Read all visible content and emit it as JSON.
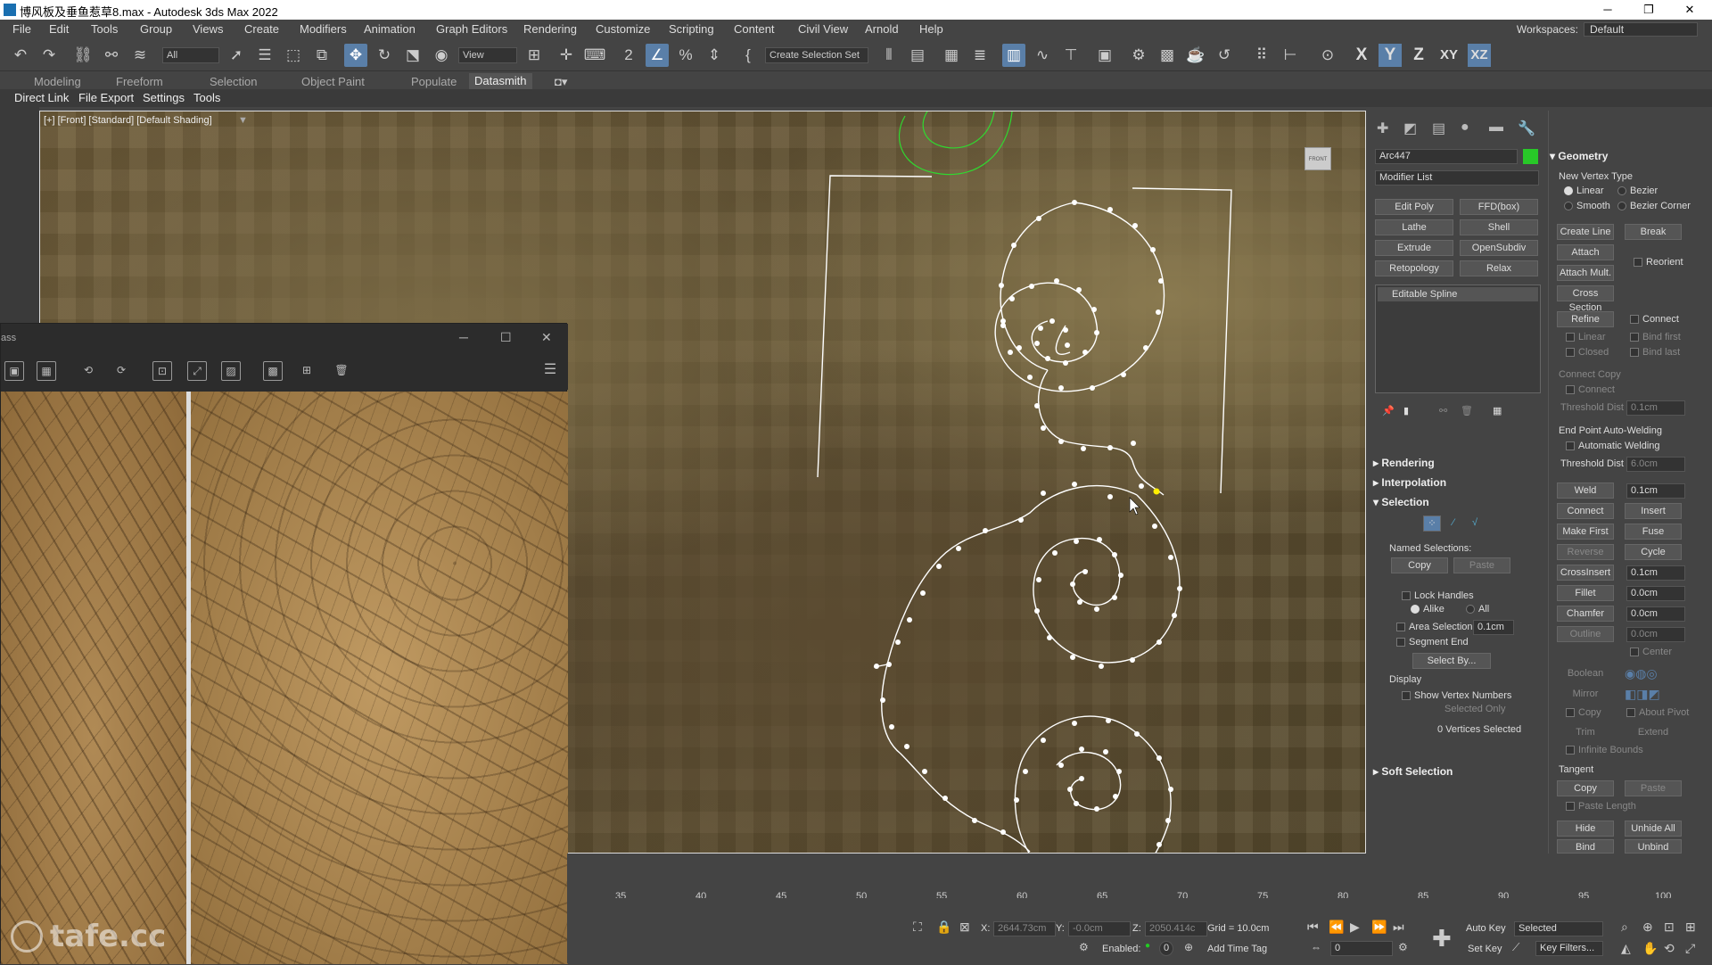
{
  "app": {
    "title": "博风板及垂鱼惹草8.max - Autodesk 3ds Max 2022"
  },
  "menu": [
    "File",
    "Edit",
    "Tools",
    "Group",
    "Views",
    "Create",
    "Modifiers",
    "Animation",
    "Graph Editors",
    "Rendering",
    "Customize",
    "Scripting",
    "Content",
    "Civil View",
    "Arnold",
    "Help"
  ],
  "workspaces": {
    "label": "Workspaces:",
    "value": "Default"
  },
  "toolbar": {
    "filter": "All",
    "refcoord": "View",
    "selset": "Create Selection Set",
    "axes": [
      "X",
      "Y",
      "Z",
      "XY",
      "XZ"
    ]
  },
  "ribbon": {
    "tabs": [
      "Modeling",
      "Freeform",
      "Selection",
      "Object Paint",
      "Populate",
      "Datasmith"
    ]
  },
  "subribbon": [
    "Direct Link",
    "File Export",
    "Settings",
    "Tools"
  ],
  "viewport": {
    "label": "[+] [Front] [Standard] [Default Shading]",
    "cube": "FRONT"
  },
  "floatwin": {
    "title": "ass"
  },
  "watermark": "tafe.cc",
  "panel": {
    "objname": "Arc447",
    "modlist": "Modifier List",
    "mods": [
      "Edit Poly",
      "FFD(box)",
      "Lathe",
      "Shell",
      "Extrude",
      "OpenSubdiv",
      "Retopology",
      "Relax"
    ],
    "stack": "Editable Spline",
    "rollouts": {
      "rendering": "Rendering",
      "interpolation": "Interpolation",
      "selection": "Selection",
      "softsel": "Soft Selection",
      "geometry": "Geometry"
    },
    "selection": {
      "named": "Named Selections:",
      "copy": "Copy",
      "paste": "Paste",
      "lock": "Lock Handles",
      "alike": "Alike",
      "all": "All",
      "area": "Area Selection",
      "areaval": "0.1cm",
      "segend": "Segment End",
      "selectby": "Select By...",
      "display": "Display",
      "shownum": "Show Vertex Numbers",
      "selonly": "Selected Only",
      "count": "0 Vertices Selected"
    },
    "geometry": {
      "nvt": "New Vertex Type",
      "linear": "Linear",
      "bezier": "Bezier",
      "smooth": "Smooth",
      "bezcorner": "Bezier Corner",
      "createline": "Create Line",
      "break": "Break",
      "attach": "Attach",
      "reorient": "Reorient",
      "attachmult": "Attach Mult.",
      "crosssection": "Cross Section",
      "refine": "Refine",
      "connect": "Connect",
      "linear2": "Linear",
      "bindfirst": "Bind first",
      "closed": "Closed",
      "bindlast": "Bind last",
      "connectcopy": "Connect Copy",
      "connect2": "Connect",
      "thresh": "Threshold Dist",
      "threshval": "0.1cm",
      "epaw": "End Point Auto-Welding",
      "autoweld": "Automatic Welding",
      "thresh2": "Threshold Dist",
      "threshval2": "6.0cm",
      "weld": "Weld",
      "weldval": "0.1cm",
      "connect3": "Connect",
      "insert": "Insert",
      "makefirst": "Make First",
      "fuse": "Fuse",
      "reverse": "Reverse",
      "cycle": "Cycle",
      "crossinsert": "CrossInsert",
      "crossval": "0.1cm",
      "fillet": "Fillet",
      "filletval": "0.0cm",
      "chamfer": "Chamfer",
      "chamferval": "0.0cm",
      "outline": "Outline",
      "outlineval": "0.0cm",
      "center": "Center",
      "boolean": "Boolean",
      "mirror": "Mirror",
      "copy": "Copy",
      "aboutpivot": "About Pivot",
      "trim": "Trim",
      "extend": "Extend",
      "infinite": "Infinite Bounds",
      "tangent": "Tangent",
      "tcopy": "Copy",
      "tpaste": "Paste",
      "pastelength": "Paste Length",
      "hide": "Hide",
      "unhideall": "Unhide All",
      "bind": "Bind",
      "unbind": "Unbind"
    }
  },
  "timeline": {
    "ticks": [
      "35",
      "40",
      "45",
      "50",
      "55",
      "60",
      "65",
      "70",
      "75",
      "80",
      "85",
      "90",
      "95",
      "100"
    ]
  },
  "status": {
    "x": "X:",
    "xval": "2644.73cm",
    "y": "Y:",
    "yval": "-0.0cm",
    "z": "Z:",
    "zval": "2050.414c",
    "grid": "Grid = 10.0cm",
    "enabled": "Enabled:",
    "addtag": "Add Time Tag",
    "autokey": "Auto Key",
    "selected": "Selected",
    "setkey": "Set Key",
    "keyfilters": "Key Filters...",
    "frame": "0",
    "zero": "0"
  }
}
